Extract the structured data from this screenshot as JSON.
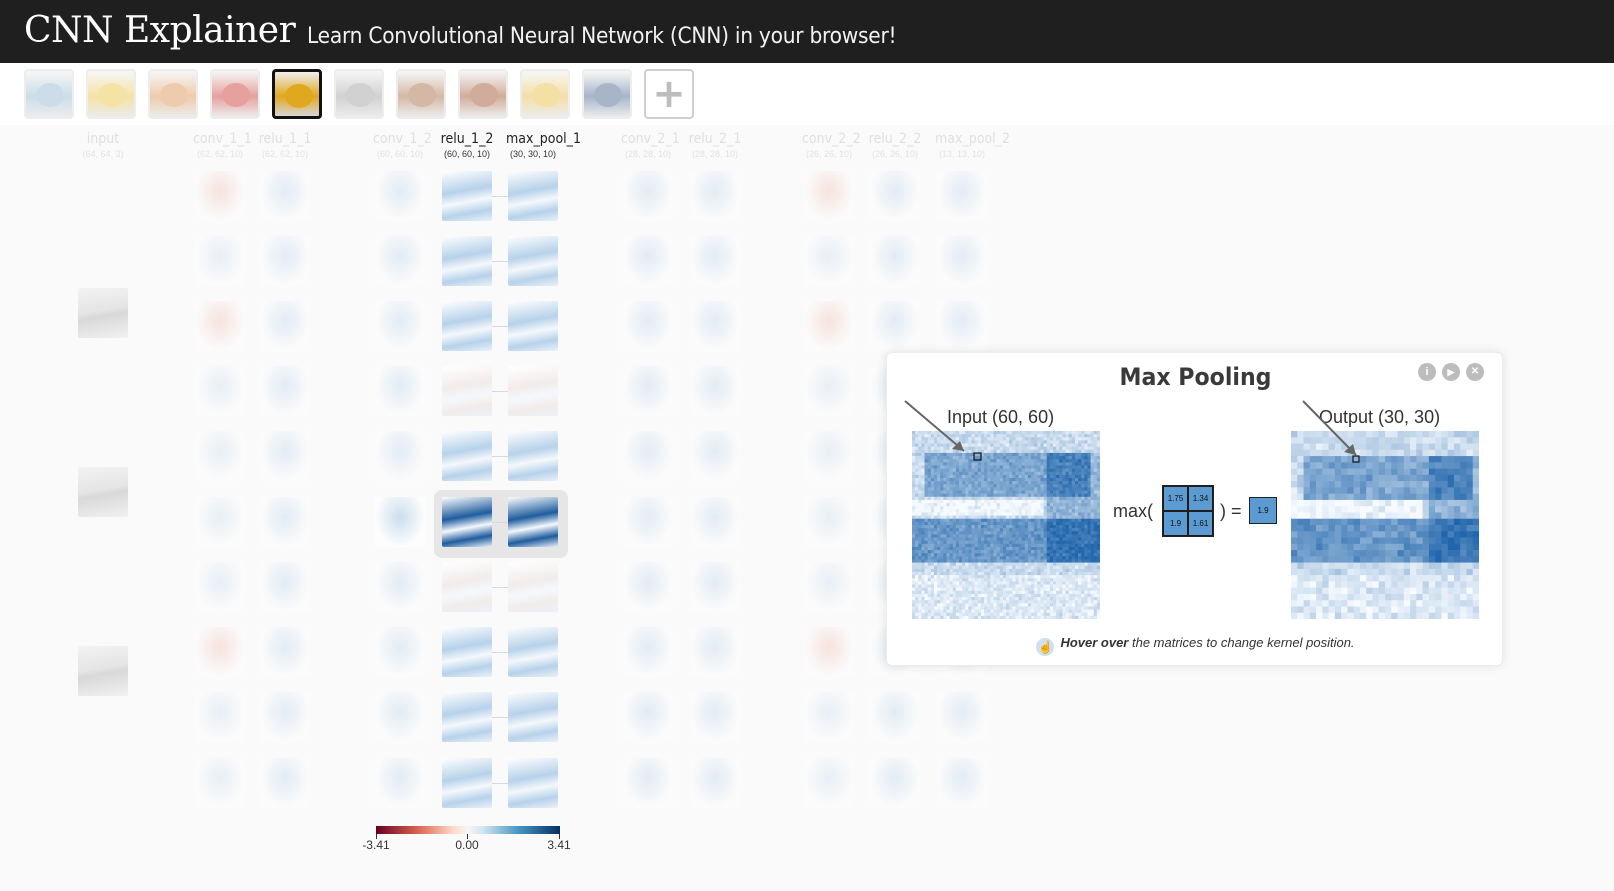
{
  "header": {
    "brand": "CNN Explainer",
    "tagline": "Learn Convolutional Neural Network (CNN) in your browser!"
  },
  "thumbnails": [
    {
      "name": "boat",
      "color": "#8fb6cf",
      "selected": false
    },
    {
      "name": "ladybug",
      "color": "#e8c23a",
      "selected": false
    },
    {
      "name": "pizza",
      "color": "#d98d4a",
      "selected": false
    },
    {
      "name": "bell-pepper",
      "color": "#c9302c",
      "selected": false
    },
    {
      "name": "school-bus",
      "color": "#e0a81e",
      "selected": true
    },
    {
      "name": "koala",
      "color": "#9a9a9a",
      "selected": false
    },
    {
      "name": "espresso",
      "color": "#a2643a",
      "selected": false
    },
    {
      "name": "red-panda",
      "color": "#9c4a24",
      "selected": false
    },
    {
      "name": "orange",
      "color": "#e8b93a",
      "selected": false
    },
    {
      "name": "sports-car",
      "color": "#3f5c8a",
      "selected": false
    }
  ],
  "add_button": "+",
  "layers": [
    {
      "name": "input",
      "dims": "(64, 64, 3)",
      "active": false
    },
    {
      "name": "conv_1_1",
      "dims": "(62, 62, 10)",
      "active": false
    },
    {
      "name": "relu_1_1",
      "dims": "(62, 62, 10)",
      "active": false
    },
    {
      "name": "conv_1_2",
      "dims": "(60, 60, 10)",
      "active": false
    },
    {
      "name": "relu_1_2",
      "dims": "(60, 60, 10)",
      "active": true
    },
    {
      "name": "max_pool_1",
      "dims": "(30, 30, 10)",
      "active": true
    },
    {
      "name": "conv_2_1",
      "dims": "(28, 28, 10)",
      "active": false
    },
    {
      "name": "relu_2_1",
      "dims": "(28, 28, 10)",
      "active": false
    },
    {
      "name": "conv_2_2",
      "dims": "(26, 26, 10)",
      "active": false
    },
    {
      "name": "relu_2_2",
      "dims": "(26, 26, 10)",
      "active": false
    },
    {
      "name": "max_pool_2",
      "dims": "(13, 13, 10)",
      "active": false
    }
  ],
  "colorbar": {
    "min_label": "-3.41",
    "mid_label": "0.00",
    "max_label": "3.41"
  },
  "modal": {
    "title": "Max Pooling",
    "info_icon": "i",
    "play_icon": "▶",
    "close_icon": "✕",
    "input_label": "Input (60, 60)",
    "output_label": "Output (30, 30)",
    "max_text": "max(",
    "close_text": ") =",
    "kernel_values": [
      "1.75",
      "1.34",
      "1.9",
      "1.61"
    ],
    "output_value": "1.9",
    "hint_bold": "Hover over",
    "hint_rest": " the matrices to change kernel position."
  }
}
